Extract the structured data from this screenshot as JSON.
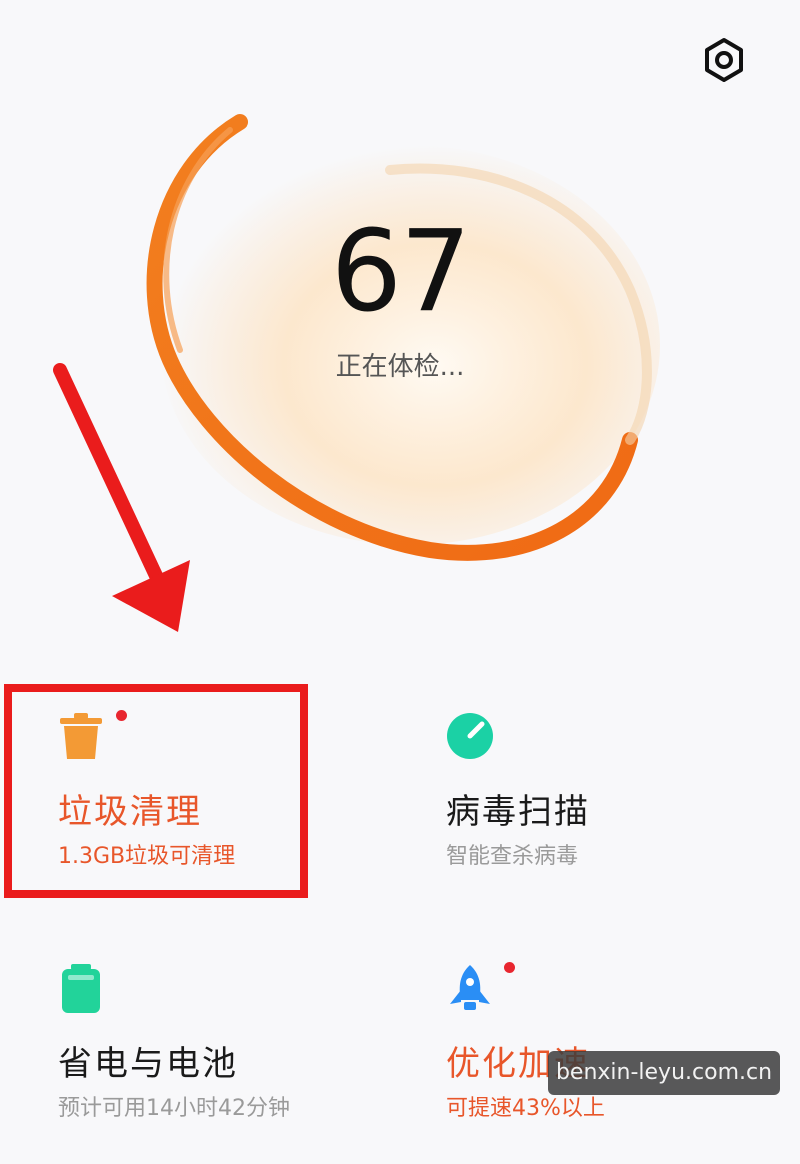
{
  "header": {
    "settings_icon": "gear-hexagon-icon"
  },
  "health_check": {
    "score": "67",
    "status": "正在体检..."
  },
  "features": [
    {
      "title": "垃圾清理",
      "subtitle": "1.3GB垃圾可清理",
      "icon": "trash-bin-icon",
      "has_badge": true,
      "accent": "#e8562a"
    },
    {
      "title": "病毒扫描",
      "subtitle": "智能查杀病毒",
      "icon": "virus-scan-icon",
      "has_badge": false,
      "accent": "#1bd1a5"
    },
    {
      "title": "省电与电池",
      "subtitle": "预计可用14小时42分钟",
      "icon": "battery-icon",
      "has_badge": false,
      "accent": "#22d39a"
    },
    {
      "title": "优化加速",
      "subtitle": "可提速43%以上",
      "icon": "rocket-icon",
      "has_badge": true,
      "accent": "#2a8ef5"
    }
  ],
  "watermark": "benxin-leyu.com.cn",
  "colors": {
    "orange": "#f07a1e",
    "highlight_red": "#ea1c1c",
    "badge_red": "#e8262f",
    "background": "#f8f8fa"
  }
}
